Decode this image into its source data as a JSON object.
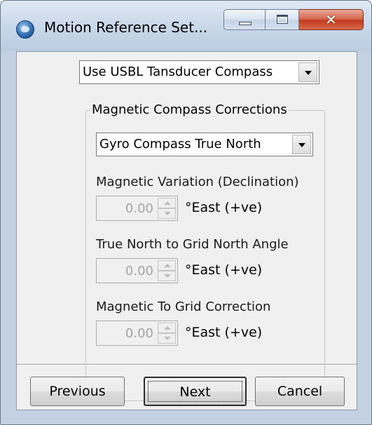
{
  "window": {
    "title": "Motion Reference Set...",
    "minimize_icon": "minimize-icon",
    "maximize_icon": "maximize-icon",
    "close_glyph": "✕",
    "close_icon": "close-icon",
    "app_icon": "globe-icon"
  },
  "source_select": {
    "value": "Use USBL Tansducer Compass"
  },
  "compass_group": {
    "legend": "Magnetic Compass Corrections",
    "reference_select": {
      "value": "Gyro Compass True North"
    },
    "fields": [
      {
        "label": "Magnetic Variation (Declination)",
        "value": "0.00",
        "unit": "°East (+ve)"
      },
      {
        "label": "True North to Grid North Angle",
        "value": "0.00",
        "unit": "°East (+ve)"
      },
      {
        "label": "Magnetic To Grid Correction",
        "value": "0.00",
        "unit": "°East (+ve)"
      }
    ]
  },
  "buttons": {
    "previous": "Previous",
    "next": "Next",
    "cancel": "Cancel"
  },
  "colors": {
    "frame": "#c3d1e2",
    "client": "#f0f0f0",
    "close_button": "#c23b1f",
    "disabled_text": "#a3a3a3"
  }
}
